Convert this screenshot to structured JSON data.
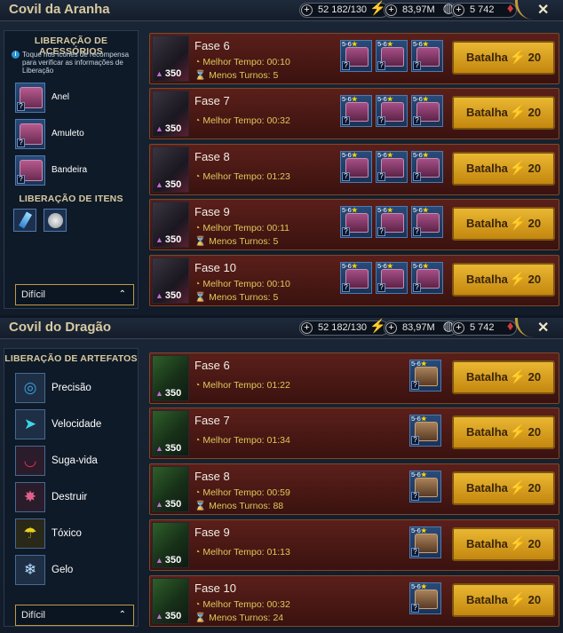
{
  "header": {
    "resources": {
      "energy": "52 182/130",
      "silver": "83,97M",
      "gems": "5 742"
    }
  },
  "spider": {
    "title": "Covil da Aranha",
    "side_heading": "LIBERAÇÃO DE ACESSÓRIOS",
    "hint": "Toque nos ícones de recompensa para verificar as informações de Liberação",
    "accessories": [
      "Anel",
      "Amuleto",
      "Bandeira"
    ],
    "items_heading": "LIBERAÇÃO DE ITENS",
    "difficulty": "Difícil",
    "rows": [
      {
        "stage": "Fase 6",
        "level": "350",
        "best_time": "Melhor Tempo: 00:10",
        "min_turns": "Menos Turnos: 5"
      },
      {
        "stage": "Fase 7",
        "level": "350",
        "best_time": "Melhor Tempo: 00:32",
        "min_turns": ""
      },
      {
        "stage": "Fase 8",
        "level": "350",
        "best_time": "Melhor Tempo: 01:23",
        "min_turns": ""
      },
      {
        "stage": "Fase 9",
        "level": "350",
        "best_time": "Melhor Tempo: 00:11",
        "min_turns": "Menos Turnos: 5"
      },
      {
        "stage": "Fase 10",
        "level": "350",
        "best_time": "Melhor Tempo: 00:10",
        "min_turns": "Menos Turnos: 5"
      }
    ]
  },
  "dragon": {
    "title": "Covil do Dragão",
    "side_heading": "LIBERAÇÃO DE ARTEFATOS",
    "sets": [
      "Precisão",
      "Velocidade",
      "Suga-vida",
      "Destruir",
      "Tóxico",
      "Gelo"
    ],
    "difficulty": "Difícil",
    "rows": [
      {
        "stage": "Fase 6",
        "level": "350",
        "best_time": "Melhor Tempo: 01:22",
        "min_turns": ""
      },
      {
        "stage": "Fase 7",
        "level": "350",
        "best_time": "Melhor Tempo: 01:34",
        "min_turns": ""
      },
      {
        "stage": "Fase 8",
        "level": "350",
        "best_time": "Melhor Tempo: 00:59",
        "min_turns": "Menos Turnos: 88"
      },
      {
        "stage": "Fase 9",
        "level": "350",
        "best_time": "Melhor Tempo: 01:13",
        "min_turns": ""
      },
      {
        "stage": "Fase 10",
        "level": "350",
        "best_time": "Melhor Tempo: 00:32",
        "min_turns": "Menos Turnos: 24"
      }
    ]
  },
  "reward": {
    "stars": "5-6",
    "unknown": "?"
  },
  "battle": {
    "label": "Batalha",
    "cost": "20"
  }
}
